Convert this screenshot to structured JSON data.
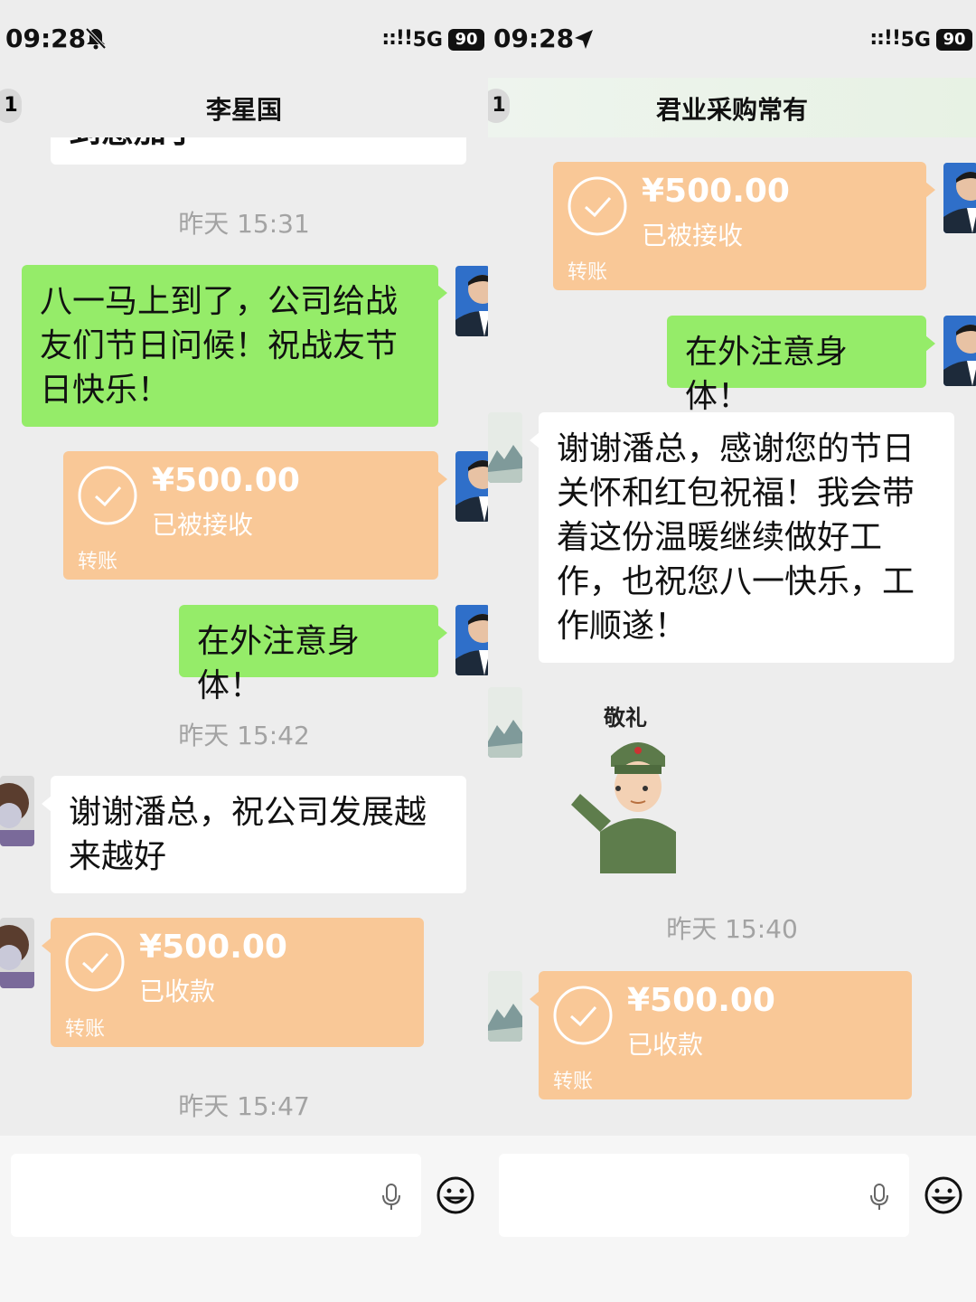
{
  "left": {
    "status": {
      "time": "09:28",
      "signal": "::!!",
      "network": "5G",
      "battery": "90"
    },
    "header": {
      "back_badge": "1",
      "title": "李星国"
    },
    "partial_message": "到惠加了",
    "timestamps": [
      "昨天 15:31",
      "昨天 15:42",
      "昨天 15:47"
    ],
    "messages": {
      "greeting": "八一马上到了，公司给战友们节日问候！祝战友节日快乐！",
      "transfer_sent": {
        "amount": "¥500.00",
        "state": "已被接收",
        "label": "转账"
      },
      "take_care": "在外注意身体！",
      "reply": "谢谢潘总，祝公司发展越来越好",
      "transfer_received": {
        "amount": "¥500.00",
        "state": "已收款",
        "label": "转账"
      }
    }
  },
  "right": {
    "status": {
      "time": "09:28",
      "signal": "::!!",
      "network": "5G",
      "battery": "90"
    },
    "header": {
      "back_badge": "1",
      "title": "君业采购常有"
    },
    "timestamps": [
      "昨天 15:40"
    ],
    "messages": {
      "transfer_sent": {
        "amount": "¥500.00",
        "state": "已被接收",
        "label": "转账"
      },
      "take_care": "在外注意身体！",
      "reply": "谢谢潘总，感谢您的节日关怀和红包祝福！我会带着这份温暖继续做好工作，也祝您八一快乐，工作顺遂！",
      "sticker_caption": "敬礼",
      "transfer_received": {
        "amount": "¥500.00",
        "state": "已收款",
        "label": "转账"
      }
    }
  },
  "icons": {
    "status_left_extra": "bell-off-icon",
    "status_right_extra": "location-arrow-icon",
    "voice": "microphone-icon",
    "emoji": "smiley-icon"
  },
  "colors": {
    "background": "#ededed",
    "green_bubble": "#95ec69",
    "transfer": "#f9c897",
    "timestamp": "#a3a3a3"
  }
}
